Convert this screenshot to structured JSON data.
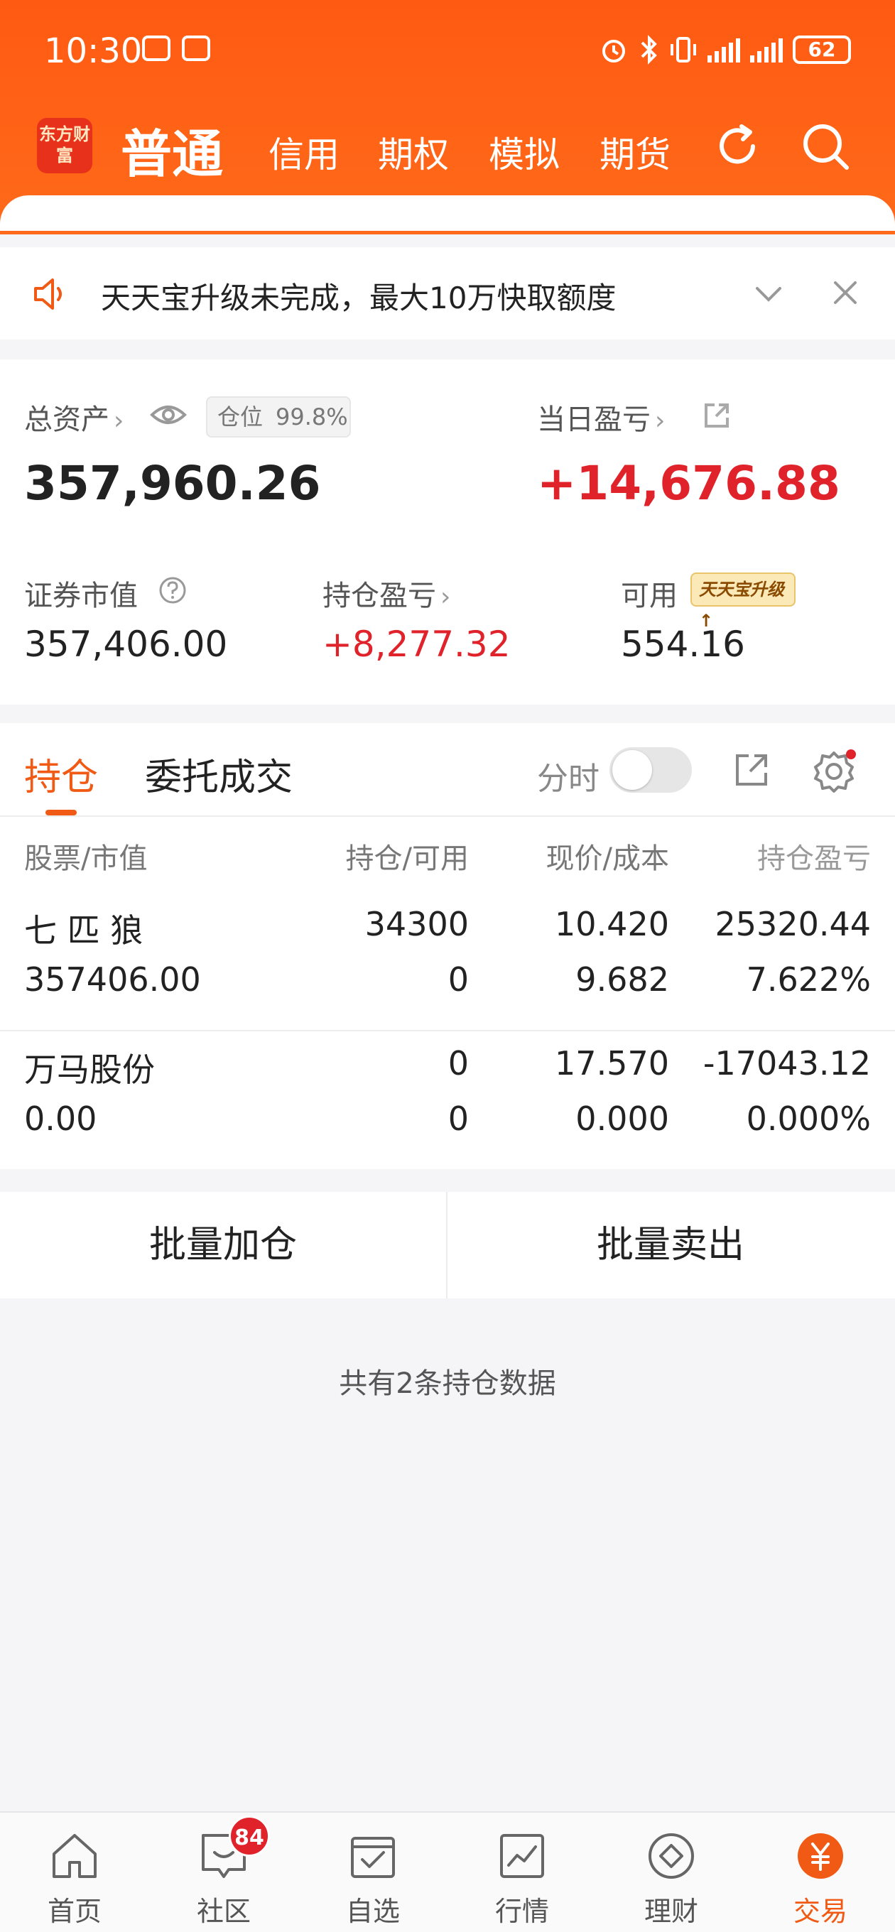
{
  "status": {
    "time": "10:30",
    "battery": "62"
  },
  "nav": {
    "logo": "东方财富",
    "tabs": [
      {
        "label": "普通"
      },
      {
        "label": "信用"
      },
      {
        "label": "期权"
      },
      {
        "label": "模拟"
      },
      {
        "label": "期货"
      }
    ]
  },
  "notice": {
    "text": "天天宝升级未完成，最大10万快取额度"
  },
  "assets": {
    "total_label": "总资产",
    "position_label": "仓位",
    "position_value": "99.8%",
    "total_value": "357,960.26",
    "daily_pl_label": "当日盈亏",
    "daily_pl_value": "+14,676.88",
    "market_value_label": "证券市值",
    "market_value": "357,406.00",
    "holding_pl_label": "持仓盈亏",
    "holding_pl_value": "+8,277.32",
    "available_label": "可用",
    "available_badge": "天天宝升级",
    "available_value": "554.16"
  },
  "holdings": {
    "tab_hold": "持仓",
    "tab_orders": "委托成交",
    "time_share_label": "分时",
    "headers": [
      "股票/市值",
      "持仓/可用",
      "现价/成本",
      "持仓盈亏"
    ],
    "rows": [
      {
        "name": "七 匹 狼",
        "value": "357406.00",
        "hold": "34300",
        "avail": "0",
        "price": "10.420",
        "cost": "9.682",
        "pl": "25320.44",
        "pl_pct": "7.622%",
        "pl_color": "#e0222b",
        "pct_color": "#e0222b"
      },
      {
        "name": "万马股份",
        "value": "0.00",
        "hold": "0",
        "avail": "0",
        "price": "17.570",
        "cost": "0.000",
        "pl": "-17043.12",
        "pl_pct": "0.000%",
        "pl_color": "#18a53a",
        "pct_color": "#18a53a"
      }
    ]
  },
  "batch": {
    "add": "批量加仓",
    "sell": "批量卖出"
  },
  "summary": "共有2条持仓数据",
  "tabbar": {
    "items": [
      {
        "label": "首页",
        "icon": "home-icon"
      },
      {
        "label": "社区",
        "icon": "chat-icon"
      },
      {
        "label": "自选",
        "icon": "checklist-icon"
      },
      {
        "label": "行情",
        "icon": "chart-icon"
      },
      {
        "label": "理财",
        "icon": "diamond-icon"
      },
      {
        "label": "交易",
        "icon": "yuan-icon"
      }
    ],
    "watch_badge": "84"
  },
  "colors": {
    "accent": "#f05a14",
    "header": "#ff5a12",
    "up": "#e0222b",
    "down": "#18a53a"
  }
}
